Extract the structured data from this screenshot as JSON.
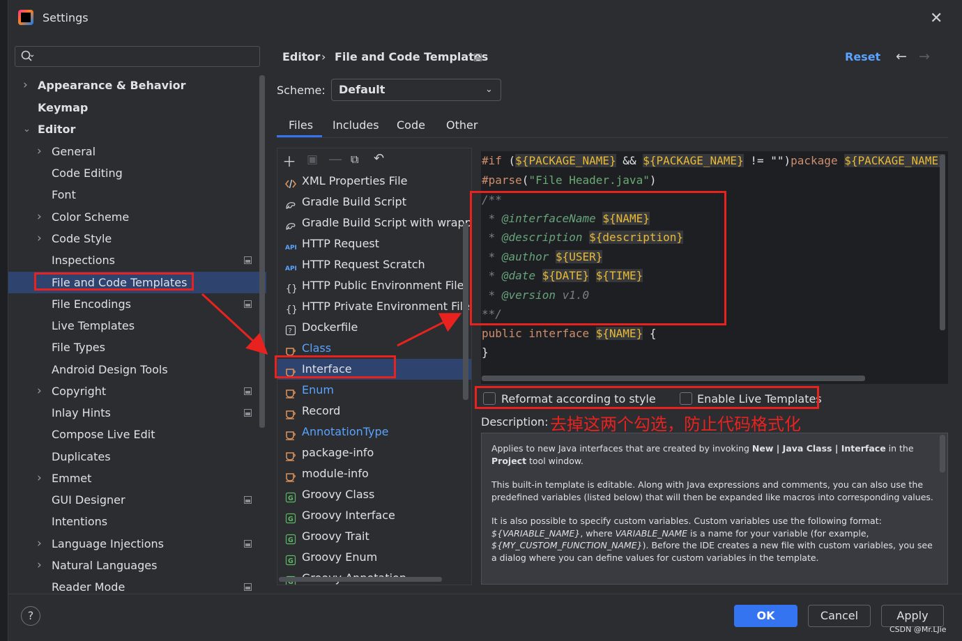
{
  "window": {
    "title": "Settings"
  },
  "search": {
    "placeholder": ""
  },
  "sidebar": {
    "items": [
      {
        "label": "Appearance & Behavior",
        "indent": 0,
        "expandable": true,
        "bold": true
      },
      {
        "label": "Keymap",
        "indent": 0,
        "expandable": false,
        "bold": true
      },
      {
        "label": "Editor",
        "indent": 0,
        "expandable": true,
        "expanded": true,
        "bold": true
      },
      {
        "label": "General",
        "indent": 1,
        "expandable": true
      },
      {
        "label": "Code Editing",
        "indent": 1
      },
      {
        "label": "Font",
        "indent": 1
      },
      {
        "label": "Color Scheme",
        "indent": 1,
        "expandable": true
      },
      {
        "label": "Code Style",
        "indent": 1,
        "expandable": true
      },
      {
        "label": "Inspections",
        "indent": 1,
        "pinned": true
      },
      {
        "label": "File and Code Templates",
        "indent": 1,
        "selected": true
      },
      {
        "label": "File Encodings",
        "indent": 1,
        "pinned": true
      },
      {
        "label": "Live Templates",
        "indent": 1
      },
      {
        "label": "File Types",
        "indent": 1
      },
      {
        "label": "Android Design Tools",
        "indent": 1
      },
      {
        "label": "Copyright",
        "indent": 1,
        "expandable": true,
        "pinned": true
      },
      {
        "label": "Inlay Hints",
        "indent": 1,
        "pinned": true
      },
      {
        "label": "Compose Live Edit",
        "indent": 1
      },
      {
        "label": "Duplicates",
        "indent": 1
      },
      {
        "label": "Emmet",
        "indent": 1,
        "expandable": true
      },
      {
        "label": "GUI Designer",
        "indent": 1,
        "pinned": true
      },
      {
        "label": "Intentions",
        "indent": 1
      },
      {
        "label": "Language Injections",
        "indent": 1,
        "expandable": true,
        "pinned": true
      },
      {
        "label": "Natural Languages",
        "indent": 1,
        "expandable": true
      },
      {
        "label": "Reader Mode",
        "indent": 1,
        "pinned": true
      }
    ]
  },
  "header": {
    "crumb1": "Editor",
    "sep": "›",
    "crumb2": "File and Code Templates",
    "reset": "Reset"
  },
  "scheme": {
    "label": "Scheme:",
    "value": "Default"
  },
  "tabs": [
    {
      "label": "Files",
      "active": true
    },
    {
      "label": "Includes"
    },
    {
      "label": "Code"
    },
    {
      "label": "Other"
    }
  ],
  "templates": [
    {
      "label": "XML Properties File",
      "icon": "xml-icon"
    },
    {
      "label": "Gradle Build Script",
      "icon": "gradle-icon"
    },
    {
      "label": "Gradle Build Script with wrapper",
      "icon": "gradle-icon"
    },
    {
      "label": "HTTP Request",
      "icon": "api-icon"
    },
    {
      "label": "HTTP Request Scratch",
      "icon": "api-icon"
    },
    {
      "label": "HTTP Public Environment File",
      "icon": "braces-icon"
    },
    {
      "label": "HTTP Private Environment File",
      "icon": "braces-icon"
    },
    {
      "label": "Dockerfile",
      "icon": "docker-icon"
    },
    {
      "label": "Class",
      "icon": "java-icon",
      "color": "#5aa3ff"
    },
    {
      "label": "Interface",
      "icon": "java-icon",
      "selected": true
    },
    {
      "label": "Enum",
      "icon": "java-icon",
      "color": "#5aa3ff"
    },
    {
      "label": "Record",
      "icon": "java-icon"
    },
    {
      "label": "AnnotationType",
      "icon": "java-icon",
      "color": "#5aa3ff"
    },
    {
      "label": "package-info",
      "icon": "java-icon"
    },
    {
      "label": "module-info",
      "icon": "java-icon"
    },
    {
      "label": "Groovy Class",
      "icon": "groovy-icon"
    },
    {
      "label": "Groovy Interface",
      "icon": "groovy-icon"
    },
    {
      "label": "Groovy Trait",
      "icon": "groovy-icon"
    },
    {
      "label": "Groovy Enum",
      "icon": "groovy-icon"
    },
    {
      "label": "Groovy Annotation",
      "icon": "groovy-icon"
    }
  ],
  "editor": {
    "lines": [
      [
        {
          "t": "#if",
          "c": "kw-dir"
        },
        {
          "t": " ("
        },
        {
          "t": "${PACKAGE_NAME}",
          "c": "var"
        },
        {
          "t": " && "
        },
        {
          "t": "${PACKAGE_NAME}",
          "c": "var"
        },
        {
          "t": " != "
        },
        {
          "t": "\"\""
        },
        {
          "t": ")"
        },
        {
          "t": "package",
          "c": "kw-dir"
        },
        {
          "t": " "
        },
        {
          "t": "${PACKAGE_NAME}",
          "c": "var"
        }
      ],
      [
        {
          "t": "#parse",
          "c": "kw-dir"
        },
        {
          "t": "("
        },
        {
          "t": "\"File Header.java\"",
          "c": "str"
        },
        {
          "t": ")"
        }
      ],
      [
        {
          "t": "/**",
          "c": "cmt"
        }
      ],
      [
        {
          "t": " * ",
          "c": "cmt"
        },
        {
          "t": "@interfaceName",
          "c": "tag"
        },
        {
          "t": " "
        },
        {
          "t": "${NAME}",
          "c": "var"
        }
      ],
      [
        {
          "t": " * ",
          "c": "cmt"
        },
        {
          "t": "@description",
          "c": "tag"
        },
        {
          "t": " "
        },
        {
          "t": "${description}",
          "c": "var"
        }
      ],
      [
        {
          "t": " * ",
          "c": "cmt"
        },
        {
          "t": "@author",
          "c": "tag"
        },
        {
          "t": " "
        },
        {
          "t": "${USER}",
          "c": "var"
        }
      ],
      [
        {
          "t": " * ",
          "c": "cmt"
        },
        {
          "t": "@date",
          "c": "tag"
        },
        {
          "t": " "
        },
        {
          "t": "${DATE}",
          "c": "var"
        },
        {
          "t": " "
        },
        {
          "t": "${TIME}",
          "c": "var"
        }
      ],
      [
        {
          "t": " * ",
          "c": "cmt"
        },
        {
          "t": "@version",
          "c": "tag"
        },
        {
          "t": " v1.0",
          "c": "cmt"
        }
      ],
      [
        {
          "t": "**/",
          "c": "cmt"
        }
      ],
      [
        {
          "t": "public interface ",
          "c": "kw-dir"
        },
        {
          "t": "${NAME}",
          "c": "var"
        },
        {
          "t": " {"
        }
      ],
      [
        {
          "t": "}"
        }
      ]
    ]
  },
  "options": {
    "reformat_label": "Reformat according to style",
    "live_label": "Enable Live Templates"
  },
  "description": {
    "label": "Description:",
    "annotation": "去掉这两个勾选，防止代码格式化",
    "p1a": "Applies to new Java interfaces that are created by invoking ",
    "p1b": "New | Java Class | Interface",
    "p1c": " in the ",
    "p1d": "Project",
    "p1e": " tool window.",
    "p2": "This built-in template is editable. Along with Java expressions and comments, you can also use the predefined variables (listed below) that will then be expanded like macros into corresponding values.",
    "p3a": "It is also possible to specify custom variables. Custom variables use the following format: ",
    "p3b": "${VARIABLE_NAME}",
    "p3c": ", where ",
    "p3d": "VARIABLE_NAME",
    "p3e": " is a name for your variable (for example, ",
    "p3f": "${MY_CUSTOM_FUNCTION_NAME}",
    "p3g": "). Before the IDE creates a new file with custom variables, you see a dialog where you can define values for custom variables in the template."
  },
  "footer": {
    "help": "?",
    "ok": "OK",
    "cancel": "Cancel",
    "apply": "Apply"
  },
  "watermark": "CSDN @Mr.LJie",
  "colors": {
    "accent": "#3574f0",
    "selection": "#2e436e",
    "annotation_red": "#e8231f",
    "link": "#5aa3ff"
  }
}
